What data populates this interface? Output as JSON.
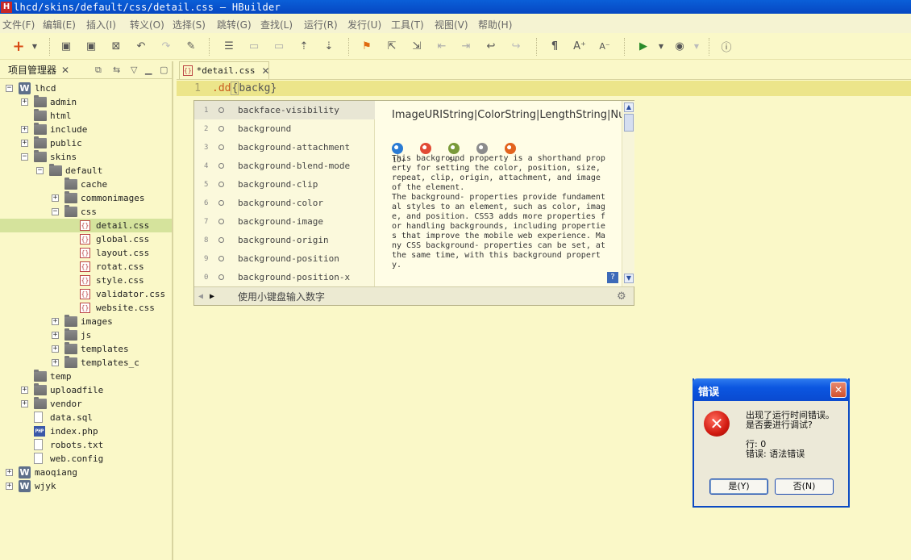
{
  "window": {
    "title": "lhcd/skins/default/css/detail.css — HBuilder",
    "app_icon": "H"
  },
  "menu": [
    "文件(F)",
    "编辑(E)",
    "插入(I)",
    "转义(O)",
    "选择(S)",
    "跳转(G)",
    "查找(L)",
    "运行(R)",
    "发行(U)",
    "工具(T)",
    "视图(V)",
    "帮助(H)"
  ],
  "project_panel": {
    "title": "项目管理器",
    "tree": [
      {
        "label": "lhcd",
        "type": "project",
        "expander": "−"
      },
      {
        "label": "admin",
        "type": "folder",
        "expander": "+"
      },
      {
        "label": "html",
        "type": "folder",
        "expander": ""
      },
      {
        "label": "include",
        "type": "folder",
        "expander": "+"
      },
      {
        "label": "public",
        "type": "folder",
        "expander": "+"
      },
      {
        "label": "skins",
        "type": "folder",
        "expander": "−"
      },
      {
        "label": "default",
        "type": "folder",
        "expander": "−"
      },
      {
        "label": "cache",
        "type": "folder",
        "expander": ""
      },
      {
        "label": "commonimages",
        "type": "folder",
        "expander": "+"
      },
      {
        "label": "css",
        "type": "folder",
        "expander": "−"
      },
      {
        "label": "detail.css",
        "type": "css",
        "expander": ""
      },
      {
        "label": "global.css",
        "type": "css",
        "expander": ""
      },
      {
        "label": "layout.css",
        "type": "css",
        "expander": ""
      },
      {
        "label": "rotat.css",
        "type": "css",
        "expander": ""
      },
      {
        "label": "style.css",
        "type": "css",
        "expander": ""
      },
      {
        "label": "validator.css",
        "type": "css",
        "expander": ""
      },
      {
        "label": "website.css",
        "type": "css",
        "expander": ""
      },
      {
        "label": "images",
        "type": "folder",
        "expander": "+"
      },
      {
        "label": "js",
        "type": "folder",
        "expander": "+"
      },
      {
        "label": "templates",
        "type": "folder",
        "expander": "+"
      },
      {
        "label": "templates_c",
        "type": "folder",
        "expander": "+"
      },
      {
        "label": "temp",
        "type": "folder",
        "expander": ""
      },
      {
        "label": "uploadfile",
        "type": "folder",
        "expander": "+"
      },
      {
        "label": "vendor",
        "type": "folder",
        "expander": "+"
      },
      {
        "label": "data.sql",
        "type": "file",
        "expander": ""
      },
      {
        "label": "index.php",
        "type": "php",
        "expander": ""
      },
      {
        "label": "robots.txt",
        "type": "file",
        "expander": ""
      },
      {
        "label": "web.config",
        "type": "file",
        "expander": ""
      },
      {
        "label": "maoqiang",
        "type": "project",
        "expander": "+"
      },
      {
        "label": "wjyk",
        "type": "project",
        "expander": "+"
      }
    ]
  },
  "editor": {
    "tab_label": "*detail.css",
    "line_number": "1",
    "code": {
      "selector": ".dd",
      "open": "{",
      "text": "backg",
      "close": "}"
    }
  },
  "autocomplete": {
    "items": [
      {
        "num": "1",
        "text": "backface-visibility"
      },
      {
        "num": "2",
        "text": "background"
      },
      {
        "num": "3",
        "text": "background-attachment"
      },
      {
        "num": "4",
        "text": "background-blend-mode"
      },
      {
        "num": "5",
        "text": "background-clip"
      },
      {
        "num": "6",
        "text": "background-color"
      },
      {
        "num": "7",
        "text": "background-image"
      },
      {
        "num": "8",
        "text": "background-origin"
      },
      {
        "num": "9",
        "text": "background-position"
      },
      {
        "num": "0",
        "text": "background-position-x"
      }
    ],
    "doc_types": "ImageURIString|ColorString|LengthString|NumberString",
    "browsers": [
      {
        "icon": "ie-icon",
        "version": "10+",
        "color": "#2a7bd4"
      },
      {
        "icon": "chrome-icon",
        "version": "",
        "color": "#e14a34"
      },
      {
        "icon": "android-icon",
        "version": "5+",
        "color": "#7a9a3a"
      },
      {
        "icon": "safari-icon",
        "version": "",
        "color": "#8c8c8c"
      },
      {
        "icon": "firefox-icon",
        "version": "",
        "color": "#e2631e"
      }
    ],
    "doc_text": "This background property is a shorthand property for setting the color, position, size, repeat, clip, origin, attachment, and image of the element.\nThe background- properties provide fundamental styles to an element, such as color, image, and position. CSS3 adds more properties for handling backgrounds, including properties that improve the mobile web experience. Many CSS background- properties can be set, at the same time, with this background property.",
    "footer_hint": "使用小键盘输入数字"
  },
  "dialog": {
    "title": "错误",
    "message_line1": "出现了运行时间错误。",
    "message_line2": "是否要进行调试?",
    "detail_line1": "行: 0",
    "detail_line2": "错误: 语法错误",
    "yes_label": "是(Y)",
    "no_label": "否(N)"
  }
}
